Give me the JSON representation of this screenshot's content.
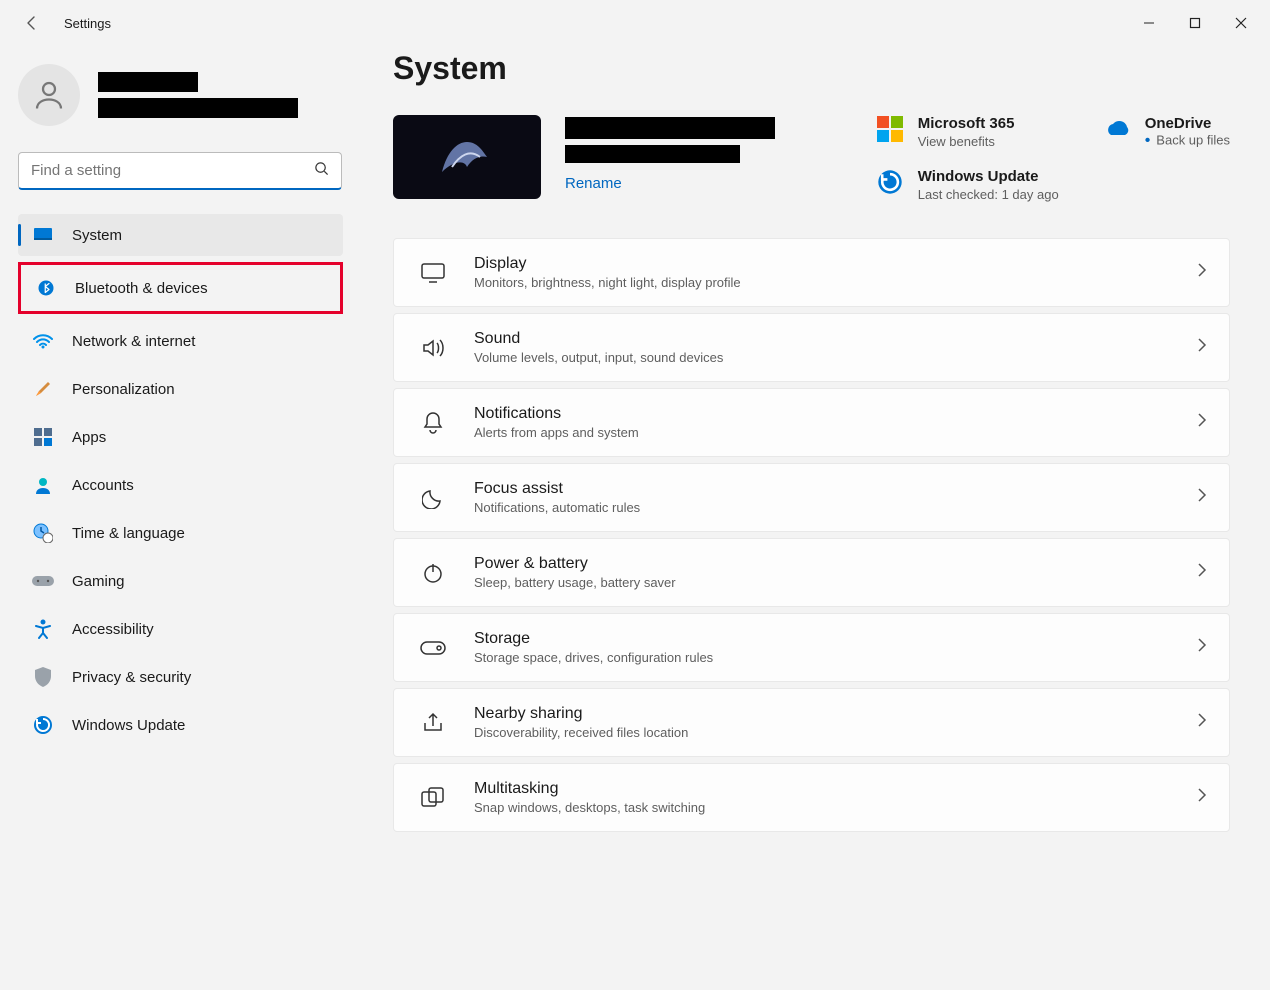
{
  "window": {
    "title": "Settings"
  },
  "search": {
    "placeholder": "Find a setting"
  },
  "nav": {
    "items": [
      {
        "label": "System"
      },
      {
        "label": "Bluetooth & devices"
      },
      {
        "label": "Network & internet"
      },
      {
        "label": "Personalization"
      },
      {
        "label": "Apps"
      },
      {
        "label": "Accounts"
      },
      {
        "label": "Time & language"
      },
      {
        "label": "Gaming"
      },
      {
        "label": "Accessibility"
      },
      {
        "label": "Privacy & security"
      },
      {
        "label": "Windows Update"
      }
    ]
  },
  "page": {
    "title": "System"
  },
  "device": {
    "rename": "Rename"
  },
  "tiles": {
    "ms365": {
      "title": "Microsoft 365",
      "sub": "View benefits"
    },
    "onedrive": {
      "title": "OneDrive",
      "sub": "Back up files"
    },
    "update": {
      "title": "Windows Update",
      "sub": "Last checked: 1 day ago"
    }
  },
  "cards": [
    {
      "title": "Display",
      "sub": "Monitors, brightness, night light, display profile"
    },
    {
      "title": "Sound",
      "sub": "Volume levels, output, input, sound devices"
    },
    {
      "title": "Notifications",
      "sub": "Alerts from apps and system"
    },
    {
      "title": "Focus assist",
      "sub": "Notifications, automatic rules"
    },
    {
      "title": "Power & battery",
      "sub": "Sleep, battery usage, battery saver"
    },
    {
      "title": "Storage",
      "sub": "Storage space, drives, configuration rules"
    },
    {
      "title": "Nearby sharing",
      "sub": "Discoverability, received files location"
    },
    {
      "title": "Multitasking",
      "sub": "Snap windows, desktops, task switching"
    }
  ]
}
